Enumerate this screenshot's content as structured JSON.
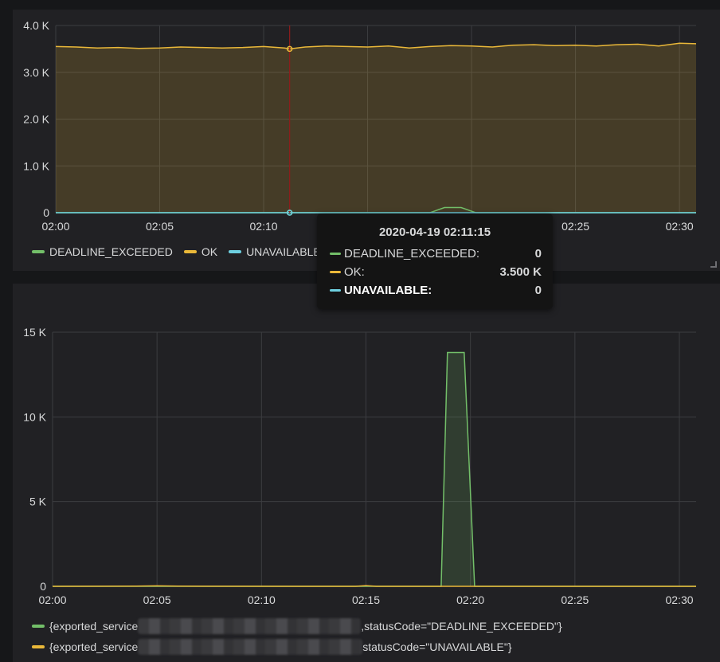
{
  "colors": {
    "deadline": "#73bf69",
    "ok": "#eab839",
    "unavailable": "#6ed0e0",
    "grid": "#3c3d40",
    "axis_text": "#d8d9da",
    "crosshair": "#8f1c1c"
  },
  "panel1": {
    "legend": [
      {
        "label": "DEADLINE_EXCEEDED",
        "color": "#73bf69"
      },
      {
        "label": "OK",
        "color": "#eab839"
      },
      {
        "label": "UNAVAILABLE",
        "color": "#6ed0e0"
      }
    ]
  },
  "tooltip": {
    "title": "2020-04-19 02:11:15",
    "rows": [
      {
        "name": "DEADLINE_EXCEEDED:",
        "value": "0",
        "color": "#73bf69"
      },
      {
        "name": "OK:",
        "value": "3.500 K",
        "color": "#eab839"
      },
      {
        "name": "UNAVAILABLE:",
        "value": "0",
        "color": "#6ed0e0"
      }
    ]
  },
  "panel2": {
    "legend": [
      {
        "prefix": "{exported_service",
        "suffix": ",statusCode=\"DEADLINE_EXCEEDED\"}",
        "color": "#73bf69"
      },
      {
        "prefix": "{exported_service",
        "suffix": "statusCode=\"UNAVAILABLE\"}",
        "color": "#eab839"
      }
    ]
  },
  "chart_data": [
    {
      "type": "area",
      "x_ticks": [
        "02:00",
        "02:05",
        "02:10",
        "02:15",
        "02:20",
        "02:25",
        "02:30"
      ],
      "y_ticks": [
        "0",
        "1.0 K",
        "2.0 K",
        "3.0 K",
        "4.0 K"
      ],
      "xlim_minutes": [
        0,
        30.8
      ],
      "ylim": [
        0,
        4000
      ],
      "grid": true,
      "hover_time_minutes": 11.25,
      "series": [
        {
          "name": "OK",
          "color": "#eab839",
          "fill": true,
          "x": [
            0,
            1,
            2,
            3,
            4,
            5,
            6,
            7,
            8,
            9,
            10,
            11,
            11.25,
            12,
            13,
            14,
            15,
            16,
            17,
            18,
            19,
            20,
            21,
            22,
            23,
            24,
            25,
            26,
            27,
            28,
            29,
            30,
            30.8
          ],
          "y": [
            3550,
            3540,
            3520,
            3530,
            3510,
            3520,
            3540,
            3530,
            3520,
            3530,
            3550,
            3520,
            3500,
            3540,
            3560,
            3550,
            3540,
            3560,
            3520,
            3550,
            3570,
            3560,
            3540,
            3580,
            3590,
            3570,
            3580,
            3560,
            3590,
            3600,
            3560,
            3620,
            3610
          ]
        },
        {
          "name": "DEADLINE_EXCEEDED",
          "color": "#73bf69",
          "fill": false,
          "x": [
            0,
            18,
            18.7,
            19.5,
            20.2,
            21,
            30.8
          ],
          "y": [
            0,
            0,
            110,
            110,
            0,
            0,
            0
          ]
        },
        {
          "name": "UNAVAILABLE",
          "color": "#6ed0e0",
          "fill": false,
          "x": [
            0,
            30.8
          ],
          "y": [
            0,
            0
          ]
        }
      ]
    },
    {
      "type": "area",
      "x_ticks": [
        "02:00",
        "02:05",
        "02:10",
        "02:15",
        "02:20",
        "02:25",
        "02:30"
      ],
      "y_ticks": [
        "0",
        "5 K",
        "10 K",
        "15 K"
      ],
      "xlim_minutes": [
        0,
        30.8
      ],
      "ylim": [
        0,
        15000
      ],
      "grid": true,
      "series": [
        {
          "name": "",
          "color": "#73bf69",
          "fill": true,
          "x": [
            0,
            18.6,
            18.9,
            19.7,
            20.2,
            30.8
          ],
          "y": [
            0,
            0,
            13800,
            13800,
            0,
            0
          ]
        },
        {
          "name": "",
          "color": "#eab839",
          "fill": false,
          "x": [
            0,
            4,
            5,
            6,
            14.5,
            15,
            15.5,
            30.8
          ],
          "y": [
            0,
            10,
            30,
            10,
            0,
            40,
            0,
            0
          ]
        }
      ]
    }
  ]
}
